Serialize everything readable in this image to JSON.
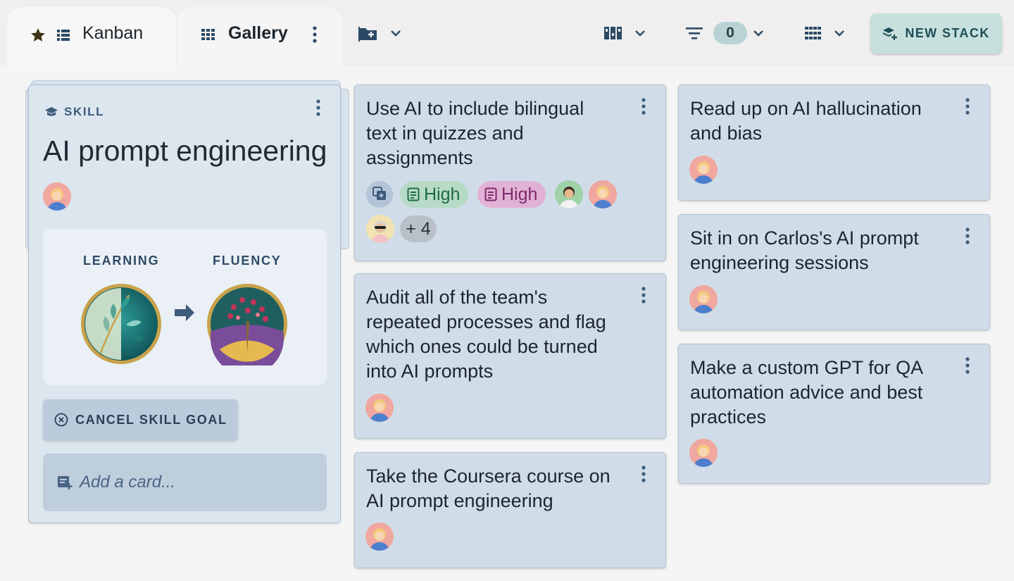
{
  "tabs": [
    {
      "label": "Kanban",
      "starred": true
    },
    {
      "label": "Gallery"
    }
  ],
  "toolbar": {
    "filter_count": "0",
    "new_stack_label": "NEW STACK"
  },
  "skill": {
    "tag": "SKILL",
    "title": "AI prompt engineering",
    "from_label": "LEARNING",
    "to_label": "FLUENCY",
    "cancel_label": "CANCEL SKILL GOAL",
    "add_card_placeholder": "Add a card..."
  },
  "cards": [
    {
      "title_lines": [
        "Use AI to include bilingual",
        "text in quizzes and",
        "assignments"
      ],
      "chips": [
        {
          "label": "High",
          "color": "#b6dac6"
        },
        {
          "label": "High",
          "color": "#e2b1d6"
        }
      ],
      "more_count": "+ 4"
    },
    {
      "title_lines": [
        "Audit all of the team's",
        "repeated processes and flag",
        "which ones could be turned",
        "into AI prompts"
      ]
    },
    {
      "title_lines": [
        "Take the Coursera course on",
        "AI prompt engineering"
      ]
    },
    {
      "title_lines": [
        "Read up on AI hallucination",
        "and bias"
      ]
    },
    {
      "title_lines": [
        "Sit in on Carlos's AI prompt",
        "engineering sessions"
      ]
    },
    {
      "title_lines": [
        "Make a custom GPT for QA",
        "automation advice and best",
        "practices"
      ]
    }
  ],
  "colors": {
    "accent": "#c7e0de",
    "card": "#d0dde8",
    "skill_card": "#dce6ef"
  }
}
